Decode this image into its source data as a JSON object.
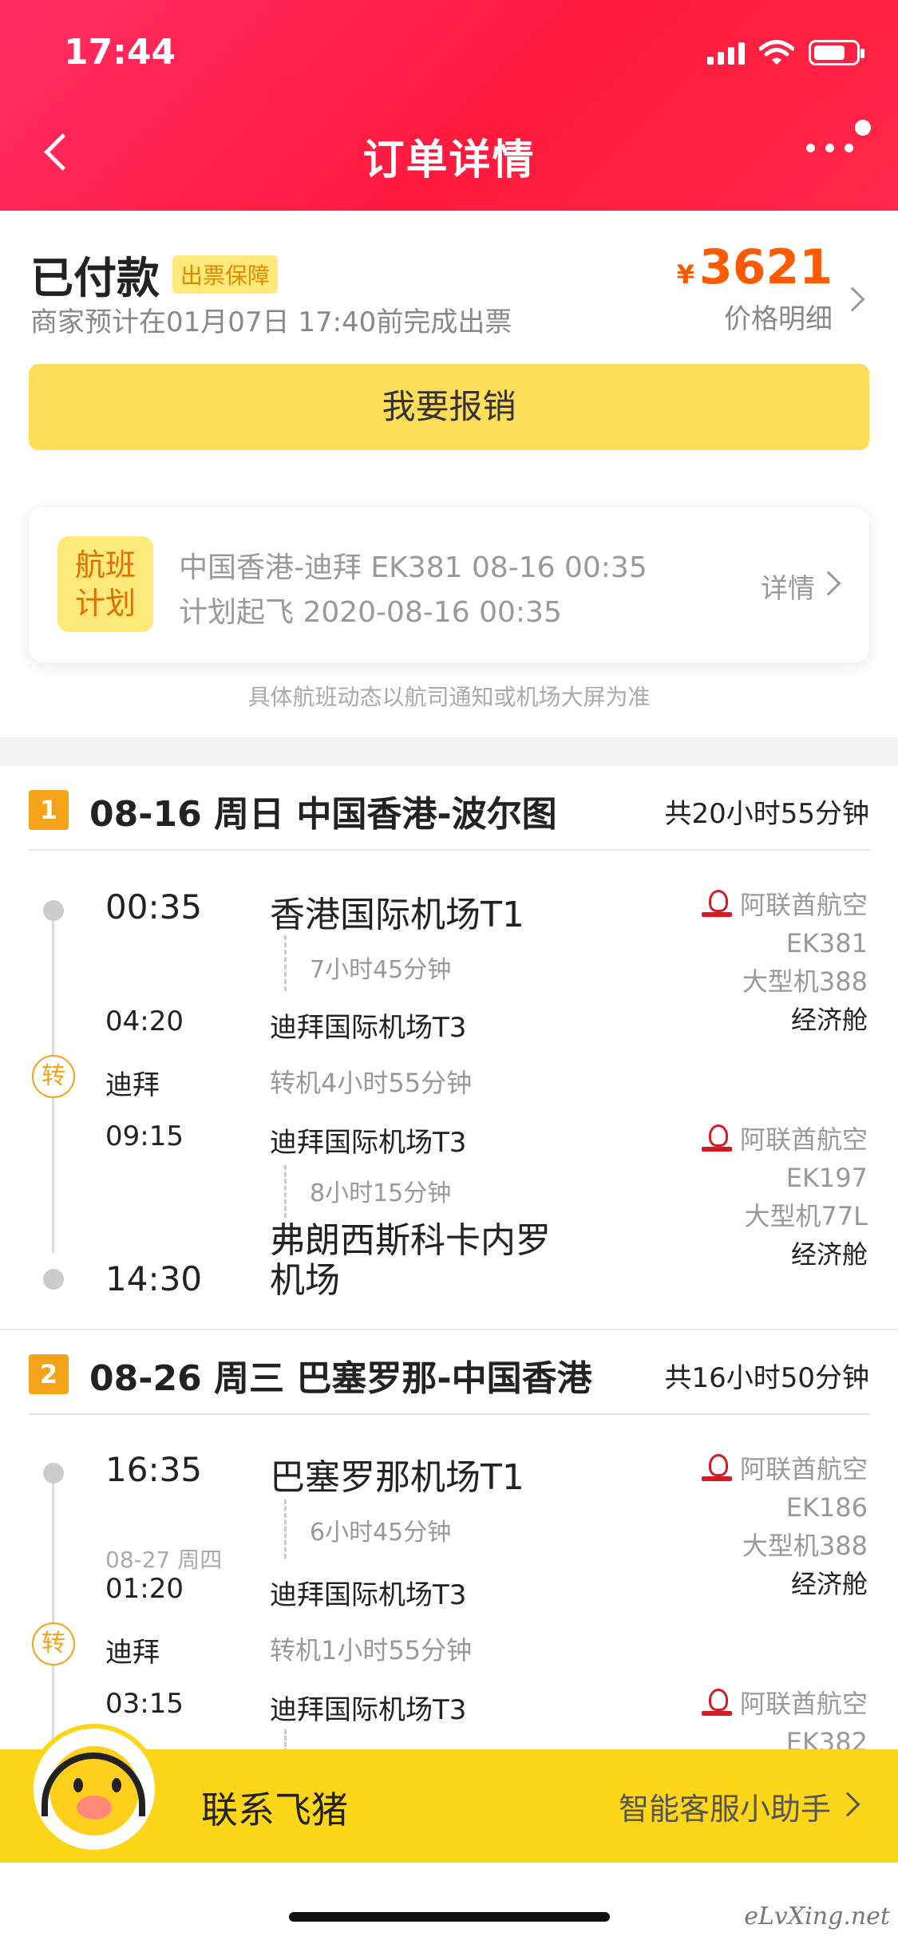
{
  "status_bar": {
    "time": "17:44"
  },
  "header": {
    "title": "订单详情"
  },
  "order": {
    "status": "已付款",
    "badge": "出票保障",
    "note": "商家预计在01月07日 17:40前完成出票",
    "currency": "¥",
    "price": "3621",
    "price_detail": "价格明细",
    "claim_button": "我要报销"
  },
  "flight_plan": {
    "icon_line1": "航班",
    "icon_line2": "计划",
    "line1": "中国香港-迪拜 EK381 08-16 00:35",
    "line2": "计划起飞 2020-08-16 00:35",
    "detail": "详情",
    "note": "具体航班动态以航司通知或机场大屏为准"
  },
  "segments": [
    {
      "num": "1",
      "title": "08-16 周日 中国香港-波尔图",
      "total": "共20小时55分钟",
      "legs": [
        {
          "dep_time": "00:35",
          "dep_airport": "香港国际机场T1",
          "duration": "7小时45分钟",
          "arr_time": "04:20",
          "arr_airport": "迪拜国际机场T3",
          "airline": "阿联酋航空",
          "flight_no": "EK381",
          "aircraft": "大型机388",
          "cabin": "经济舱"
        },
        {
          "dep_time": "09:15",
          "dep_airport": "迪拜国际机场T3",
          "duration": "8小时15分钟",
          "arr_time": "14:30",
          "arr_airport_1": "弗朗西斯科卡内罗",
          "arr_airport_2": "机场",
          "airline": "阿联酋航空",
          "flight_no": "EK197",
          "aircraft": "大型机77L",
          "cabin": "经济舱"
        }
      ],
      "transfer": {
        "icon": "转",
        "city": "迪拜",
        "duration": "转机4小时55分钟"
      }
    },
    {
      "num": "2",
      "title": "08-26 周三 巴塞罗那-中国香港",
      "total": "共16小时50分钟",
      "legs": [
        {
          "dep_time": "16:35",
          "dep_airport": "巴塞罗那机场T1",
          "duration": "6小时45分钟",
          "arr_date": "08-27 周四",
          "arr_time": "01:20",
          "arr_airport": "迪拜国际机场T3",
          "airline": "阿联酋航空",
          "flight_no": "EK186",
          "aircraft": "大型机388",
          "cabin": "经济舱"
        },
        {
          "dep_time": "03:15",
          "dep_airport": "迪拜国际机场T3",
          "airline": "阿联酋航空",
          "flight_no": "EK382"
        }
      ],
      "transfer": {
        "icon": "转",
        "city": "迪拜",
        "duration": "转机1小时55分钟"
      }
    }
  ],
  "bottom_bar": {
    "contact": "联系飞猪",
    "assistant": "智能客服小助手"
  },
  "watermark": "eLvXing.net",
  "colors": {
    "header": "#ff1a3d",
    "accent": "#ff5a00",
    "button": "#fedd5b",
    "bottom_bar": "#fdd61a",
    "segment_badge": "#f5a31a"
  }
}
